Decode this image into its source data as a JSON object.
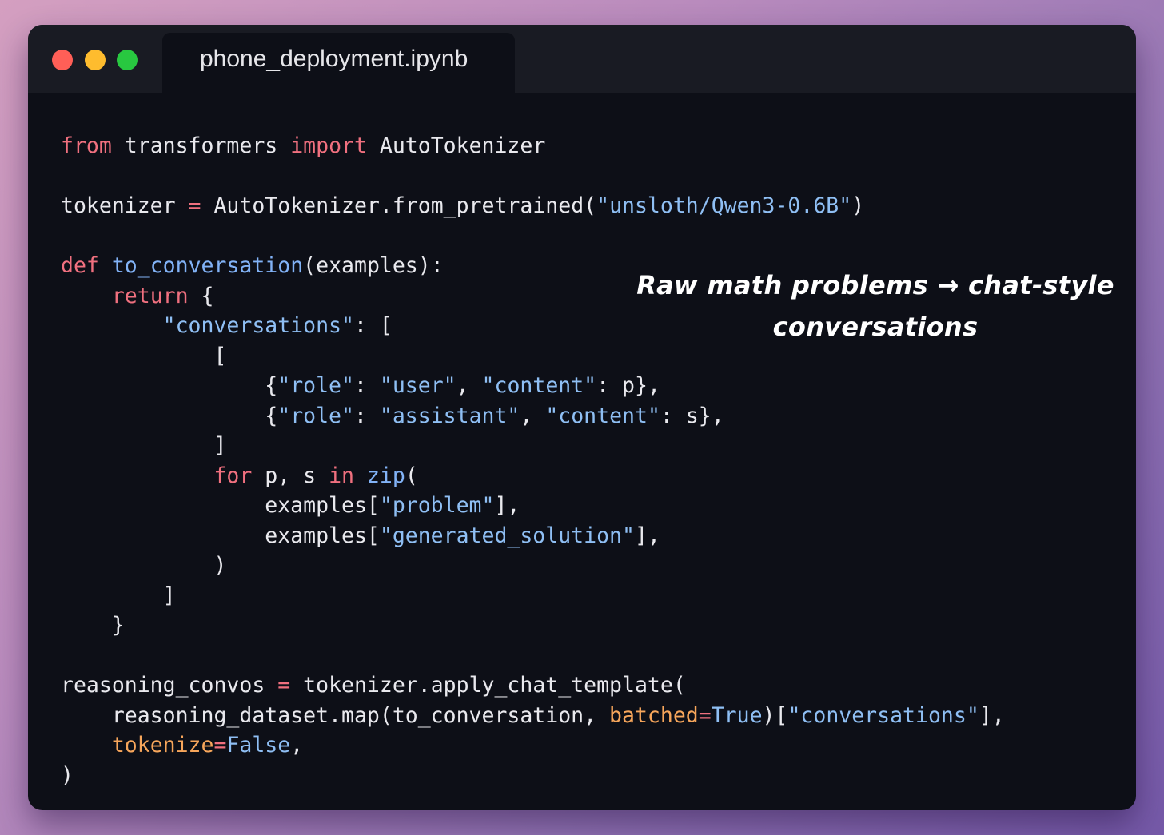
{
  "window": {
    "tab_title": "phone_deployment.ipynb"
  },
  "annotation": {
    "line1": "Raw math problems → chat-style",
    "line2": "conversations"
  },
  "code": {
    "l1": {
      "a": "from",
      "b": " transformers ",
      "c": "import",
      "d": " AutoTokenizer"
    },
    "l3": {
      "a": "tokenizer ",
      "b": "=",
      "c": " AutoTokenizer.from_pretrained(",
      "d": "\"unsloth/Qwen3-0.6B\"",
      "e": ")"
    },
    "l5": {
      "a": "def",
      "b": " ",
      "c": "to_conversation",
      "d": "(examples):"
    },
    "l6": {
      "a": "    ",
      "b": "return",
      "c": " {"
    },
    "l7": {
      "a": "        ",
      "b": "\"conversations\"",
      "c": ": ["
    },
    "l8": {
      "a": "            ["
    },
    "l9": {
      "a": "                {",
      "b": "\"role\"",
      "c": ": ",
      "d": "\"user\"",
      "e": ", ",
      "f": "\"content\"",
      "g": ": p},"
    },
    "l10": {
      "a": "                {",
      "b": "\"role\"",
      "c": ": ",
      "d": "\"assistant\"",
      "e": ", ",
      "f": "\"content\"",
      "g": ": s},"
    },
    "l11": {
      "a": "            ]"
    },
    "l12": {
      "a": "            ",
      "b": "for",
      "c": " p, s ",
      "d": "in",
      "e": " ",
      "f": "zip",
      "g": "("
    },
    "l13": {
      "a": "                examples[",
      "b": "\"problem\"",
      "c": "],"
    },
    "l14": {
      "a": "                examples[",
      "b": "\"generated_solution\"",
      "c": "],"
    },
    "l15": {
      "a": "            )"
    },
    "l16": {
      "a": "        ]"
    },
    "l17": {
      "a": "    }"
    },
    "l19": {
      "a": "reasoning_convos ",
      "b": "=",
      "c": " tokenizer.apply_chat_template("
    },
    "l20": {
      "a": "    reasoning_dataset.map(to_conversation, ",
      "b": "batched",
      "c": "=",
      "d": "True",
      "e": ")[",
      "f": "\"conversations\"",
      "g": "],"
    },
    "l21": {
      "a": "    ",
      "b": "tokenize",
      "c": "=",
      "d": "False",
      "e": ","
    },
    "l22": {
      "a": ")"
    }
  },
  "colors": {
    "background_gradient_start": "#d49fc0",
    "background_gradient_end": "#7559a8",
    "editor_bg": "#0d0f17",
    "titlebar_bg": "#191b23",
    "keyword": "#f0707f",
    "function": "#82b3f7",
    "string": "#8fbff4",
    "parameter": "#f7a65b",
    "close_dot": "#ff5f57",
    "minimize_dot": "#febc2e",
    "maximize_dot": "#28c840"
  }
}
